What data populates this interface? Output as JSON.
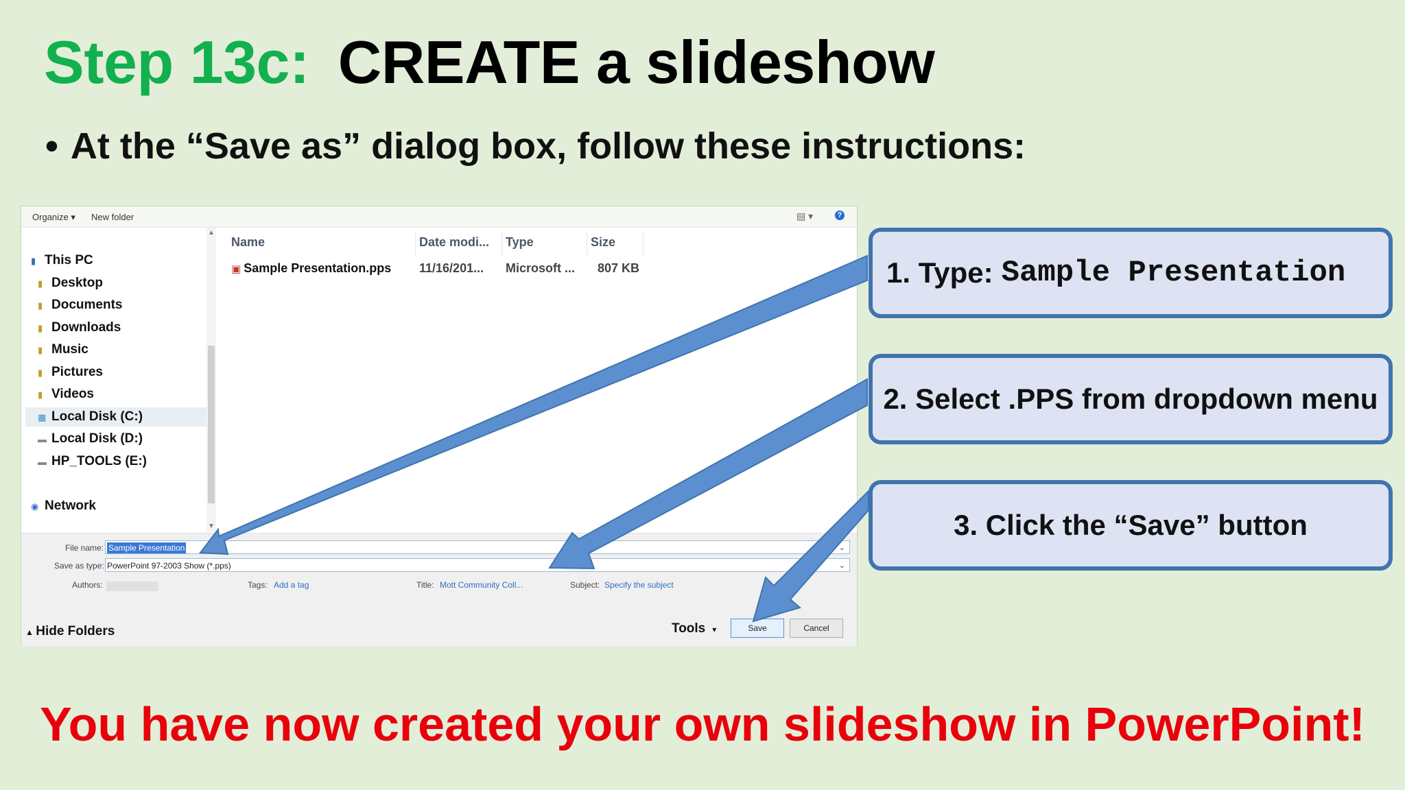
{
  "slide": {
    "title_step": "Step 13c:",
    "title_main": "CREATE  a  slideshow",
    "bullet_text": "At the “Save as” dialog box, follow these instructions:",
    "conclusion": "You have now created your own slideshow in PowerPoint!"
  },
  "dialog": {
    "toolbar": {
      "organize": "Organize ▾",
      "new_folder": "New folder"
    },
    "nav": [
      {
        "label": "This PC",
        "icon": "pc-icon"
      },
      {
        "label": "Desktop",
        "icon": "folder-icon"
      },
      {
        "label": "Documents",
        "icon": "folder-icon"
      },
      {
        "label": "Downloads",
        "icon": "folder-icon"
      },
      {
        "label": "Music",
        "icon": "folder-icon"
      },
      {
        "label": "Pictures",
        "icon": "folder-icon"
      },
      {
        "label": "Videos",
        "icon": "folder-icon"
      },
      {
        "label": "Local Disk (C:)",
        "icon": "drive-icon",
        "selected": true
      },
      {
        "label": "Local Disk (D:)",
        "icon": "drive-icon"
      },
      {
        "label": "HP_TOOLS (E:)",
        "icon": "drive-icon"
      },
      {
        "label": "Network",
        "icon": "network-icon"
      }
    ],
    "columns": [
      "Name",
      "Date modi...",
      "Type",
      "Size"
    ],
    "files": [
      {
        "name": "Sample Presentation.pps",
        "date": "11/16/201...",
        "type": "Microsoft ...",
        "size": "807 KB"
      }
    ],
    "file_name_label": "File name:",
    "file_name_value": "Sample Presentation",
    "save_type_label": "Save as type:",
    "save_type_value": "PowerPoint 97-2003 Show (*.pps)",
    "authors_label": "Authors:",
    "tags_label": "Tags:",
    "tags_value": "Add a tag",
    "title_label": "Title:",
    "title_value": "Mott Community Coll...",
    "subject_label": "Subject:",
    "subject_value": "Specify the subject",
    "hide_folders": "Hide Folders",
    "tools": "Tools",
    "save_button": "Save",
    "cancel_button": "Cancel"
  },
  "callouts": {
    "c1_prefix": "1.  Type:",
    "c1_value": "Sample Presentation",
    "c2": "2. Select .PPS from dropdown menu",
    "c3": "3. Click the “Save” button"
  },
  "colors": {
    "background": "#e3eed9",
    "step_green": "#12b04f",
    "callout_fill": "#dde3f2",
    "callout_border": "#3f74ae",
    "arrow_blue": "#5b8fd0",
    "conclusion_red": "#e8000b"
  }
}
